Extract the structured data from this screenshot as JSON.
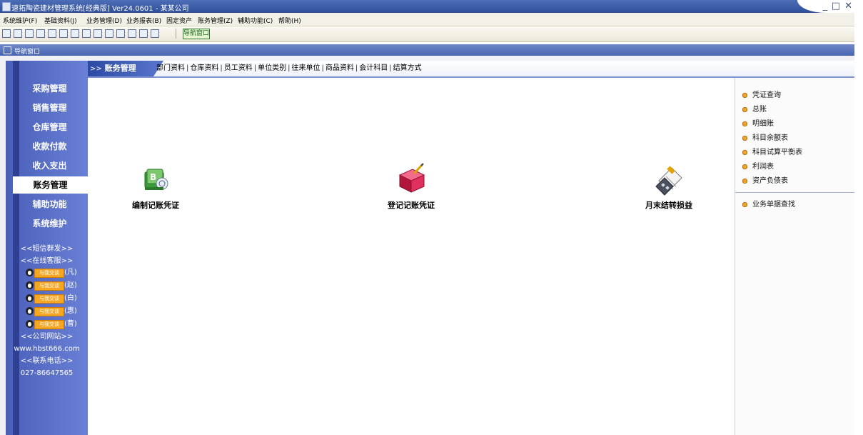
{
  "window": {
    "title": "速拓陶瓷建材管理系统[经典版] Ver24.0601 - 某某公司",
    "controls": [
      "_",
      "□",
      "✕"
    ]
  },
  "menu": {
    "items": [
      "系统维护(F)",
      "基础资料(J)",
      "业务管理(D)",
      "业务报表(B)",
      "固定资产",
      "账务管理(Z)",
      "辅助功能(C)",
      "帮助(H)"
    ]
  },
  "toolbar": {
    "nav_window_label": "导航窗口"
  },
  "panel": {
    "title": "导航窗口"
  },
  "sidebar": {
    "items": [
      {
        "label": "采购管理",
        "active": false
      },
      {
        "label": "销售管理",
        "active": false
      },
      {
        "label": "仓库管理",
        "active": false
      },
      {
        "label": "收款付款",
        "active": false
      },
      {
        "label": "收入支出",
        "active": false
      },
      {
        "label": "账务管理",
        "active": true
      },
      {
        "label": "辅助功能",
        "active": false
      },
      {
        "label": "系统维护",
        "active": false
      }
    ],
    "sms_link": "<<短信群发>>",
    "online_service": "<<在线客服>>",
    "qq_button_text": "与我交谈",
    "qq_contacts": [
      "(凡)",
      "(赵)",
      "(白)",
      "(惠)",
      "(曹)"
    ],
    "website_label": "<<公司网站>>",
    "website": "www.hbst666.com",
    "phone_label": "<<联系电话>>",
    "phone": "027-86647565"
  },
  "tabs": {
    "arrow": ">>",
    "active": "账务管理",
    "links": [
      "部门资料",
      "仓库资料",
      "员工资料",
      "单位类别",
      "往来单位",
      "商品资料",
      "会计科目",
      "结算方式"
    ]
  },
  "main": {
    "actions": [
      {
        "label": "编制记账凭证",
        "icon": "voucher-edit-icon"
      },
      {
        "label": "登记记账凭证",
        "icon": "ledger-book-icon"
      },
      {
        "label": "月末结转损益",
        "icon": "month-end-calculator-icon"
      }
    ]
  },
  "right_panel": {
    "reports": [
      "凭证查询",
      "总账",
      "明细账",
      "科目余额表",
      "科目试算平衡表",
      "利润表",
      "资产负债表"
    ],
    "extra": [
      "业务单据查找"
    ]
  }
}
